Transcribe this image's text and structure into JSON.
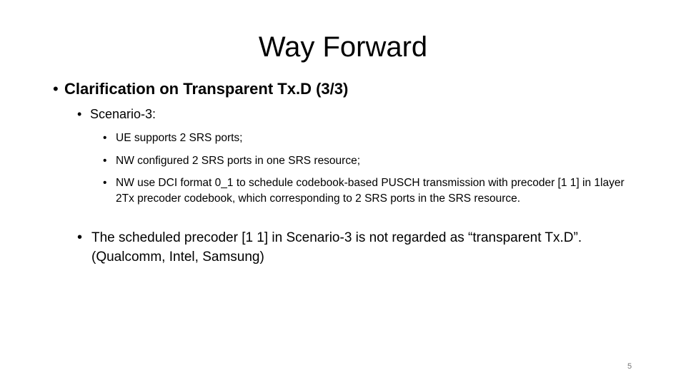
{
  "slide": {
    "title": "Way Forward",
    "bullets": {
      "heading": "Clarification on Transparent Tx.D (3/3)",
      "scenario": "Scenario-3:",
      "sub_items": [
        "UE supports 2 SRS ports;",
        "NW configured 2 SRS ports in one SRS resource;",
        "NW use DCI format 0_1 to schedule codebook-based PUSCH transmission with precoder [1 1] in 1layer 2Tx precoder codebook, which corresponding to 2 SRS ports in the SRS resource."
      ],
      "conclusion": "The scheduled precoder [1 1] in Scenario-3 is not regarded as “transparent Tx.D”. (Qualcomm, Intel, Samsung)"
    },
    "bullet_glyph": "•",
    "page_number": "5"
  }
}
